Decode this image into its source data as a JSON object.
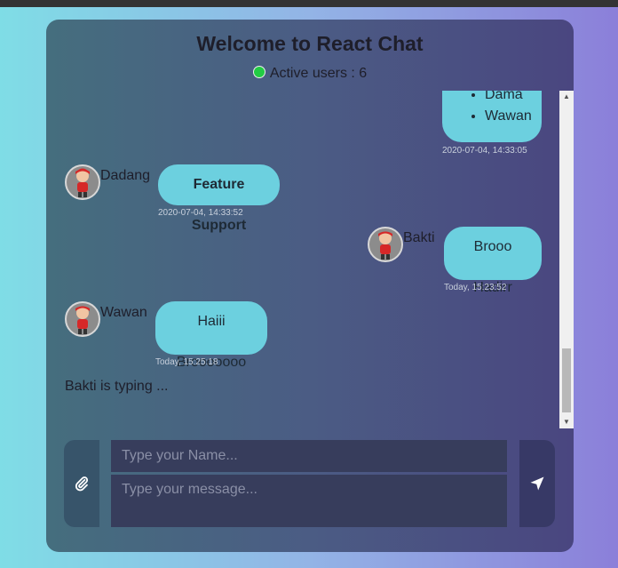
{
  "header": {
    "title": "Welcome to React Chat",
    "active_users": "Active users : 6"
  },
  "messages": {
    "list_partial_item": "Dama",
    "list_item": "Wawan",
    "list_time": "2020-07-04, 14:33:05",
    "m1": {
      "user": "Dadang",
      "text": "Feature Support",
      "time": "2020-07-04, 14:33:52"
    },
    "m2": {
      "user": "Bakti",
      "text": "Brooo Hadirr",
      "time": "Today, 15:23:52"
    },
    "m3": {
      "user": "Wawan",
      "text": "Haiii Brooooooo",
      "time": "Today, 15:25:18"
    }
  },
  "typing_indicator": "Bakti is typing ...",
  "composer": {
    "name_placeholder": "Type your Name...",
    "message_placeholder": "Type your message..."
  },
  "icons": {
    "attach": "paperclip-icon",
    "send": "send-icon",
    "status": "online-dot"
  },
  "colors": {
    "bubble": "#6cd0df",
    "online": "#22cc44"
  }
}
